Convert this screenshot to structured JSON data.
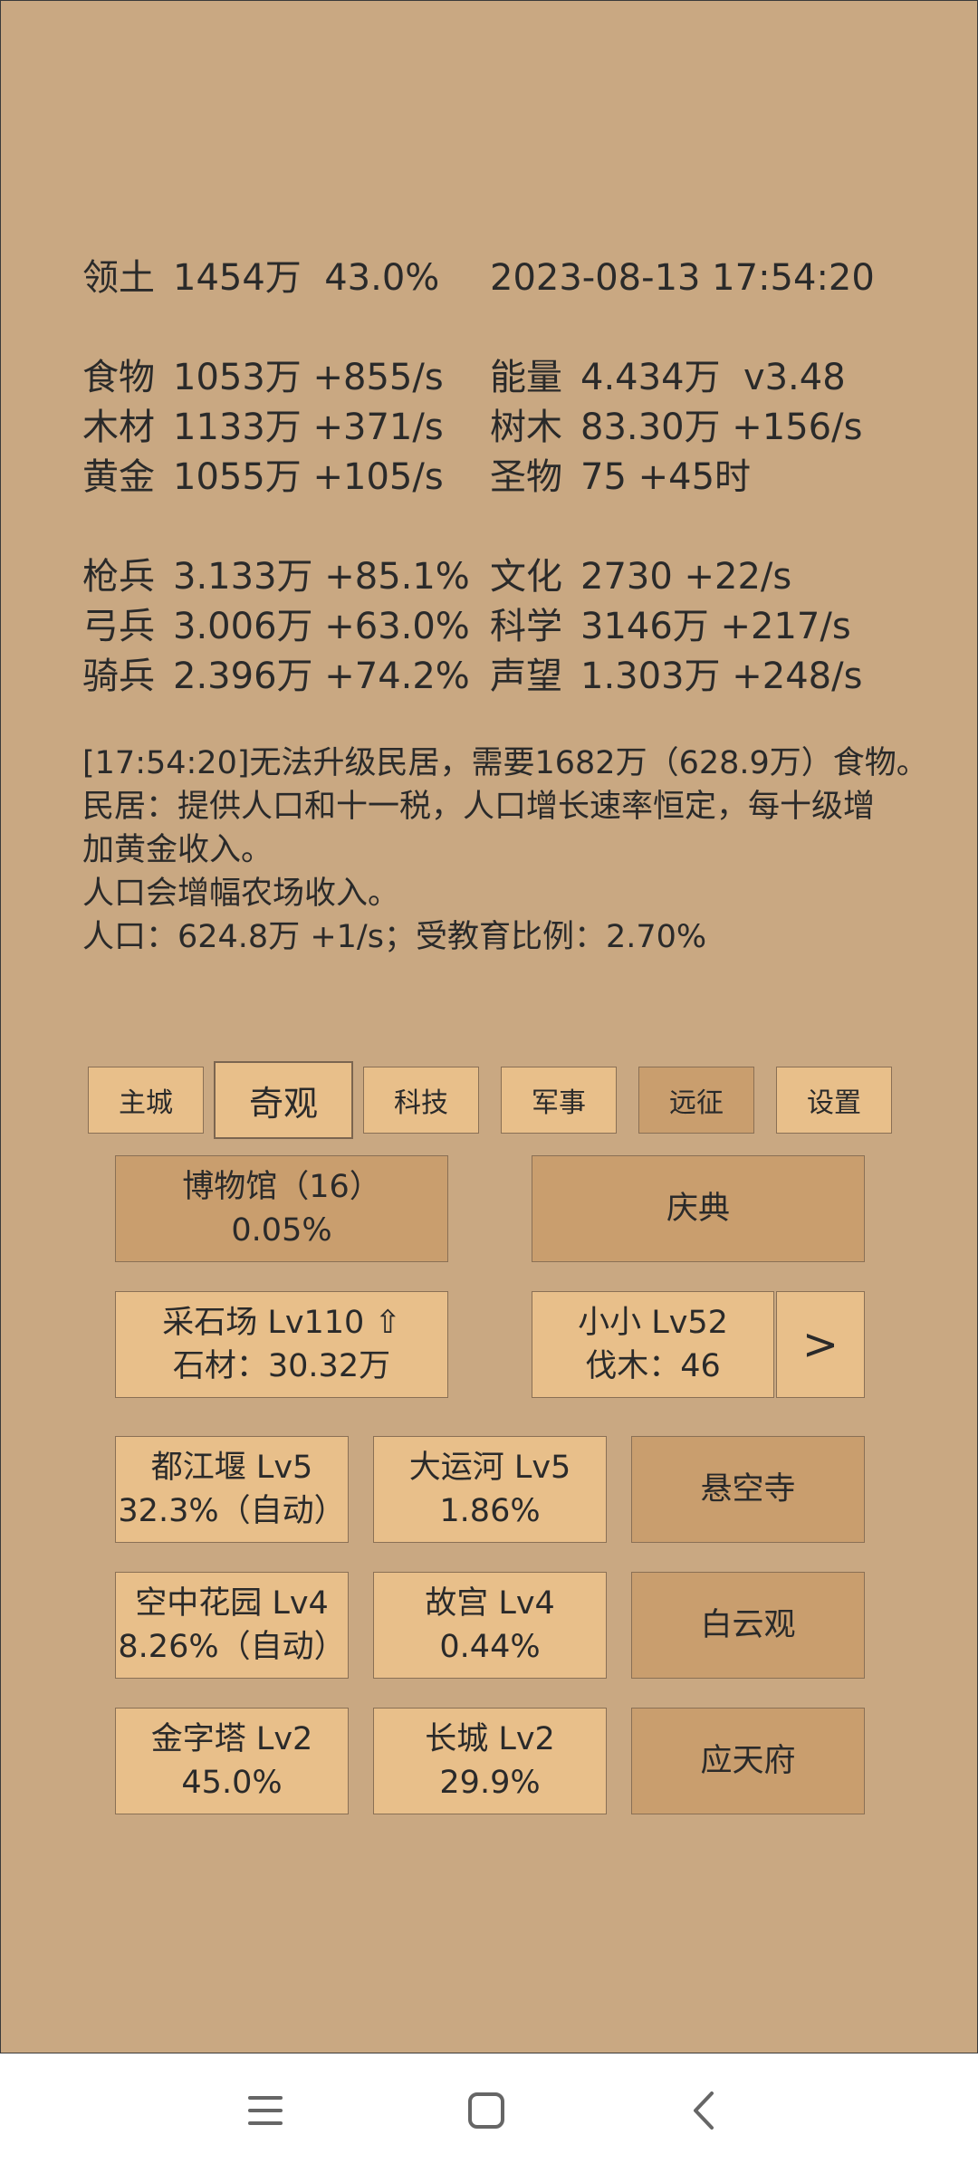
{
  "territory": {
    "label": "领土",
    "value": "1454万",
    "pct": "43.0%",
    "datetime": "2023-08-13 17:54:20"
  },
  "resources_left": [
    {
      "label": "食物",
      "value": "1053万 +855/s"
    },
    {
      "label": "木材",
      "value": "1133万 +371/s"
    },
    {
      "label": "黄金",
      "value": "1055万 +105/s"
    }
  ],
  "resources_right": [
    {
      "label": "能量",
      "value": "4.434万  v3.48"
    },
    {
      "label": "树木",
      "value": "83.30万 +156/s"
    },
    {
      "label": "圣物",
      "value": "75 +45时"
    }
  ],
  "military": [
    {
      "label": "枪兵",
      "value": "3.133万 +85.1%"
    },
    {
      "label": "弓兵",
      "value": "3.006万 +63.0%"
    },
    {
      "label": "骑兵",
      "value": "2.396万 +74.2%"
    }
  ],
  "culture": [
    {
      "label": "文化",
      "value": "2730 +22/s"
    },
    {
      "label": "科学",
      "value": "3146万 +217/s"
    },
    {
      "label": "声望",
      "value": "1.303万 +248/s"
    }
  ],
  "log": [
    "[17:54:20]无法升级民居，需要1682万（628.9万）食物。",
    "民居：提供人口和十一税，人口增长速率恒定，每十级增",
    "加黄金收入。",
    "人口会增幅农场收入。",
    "人口：624.8万 +1/s；受教育比例：2.70%"
  ],
  "tabs": [
    "主城",
    "奇观",
    "科技",
    "军事",
    "远征",
    "设置"
  ],
  "active_tab": "奇观",
  "museum": {
    "title": "博物馆（16）",
    "value": "0.05%"
  },
  "festival": {
    "label": "庆典"
  },
  "quarry": {
    "title": "采石场 Lv110 ⇧",
    "value": "石材：30.32万"
  },
  "worker": {
    "title": "小小 Lv52",
    "value": "伐木：46",
    "next": ">"
  },
  "wonders": [
    {
      "title": "都江堰 Lv5",
      "value": "32.3%（自动）"
    },
    {
      "title": "大运河 Lv5",
      "value": "1.86%"
    },
    {
      "title": "悬空寺",
      "value": ""
    },
    {
      "title": "空中花园 Lv4",
      "value": "8.26%（自动）"
    },
    {
      "title": "故宫 Lv4",
      "value": "0.44%"
    },
    {
      "title": "白云观",
      "value": ""
    },
    {
      "title": "金字塔 Lv2",
      "value": "45.0%"
    },
    {
      "title": "长城 Lv2",
      "value": "29.9%"
    },
    {
      "title": "应天府",
      "value": ""
    }
  ],
  "navbar": {
    "icons": [
      "menu-icon",
      "home-square-icon",
      "back-chevron-icon"
    ]
  },
  "colors": {
    "background": "#c9a882",
    "button_light": "#e8bf8a",
    "button_dark": "#c99e6e",
    "text": "#2a2a2a"
  }
}
